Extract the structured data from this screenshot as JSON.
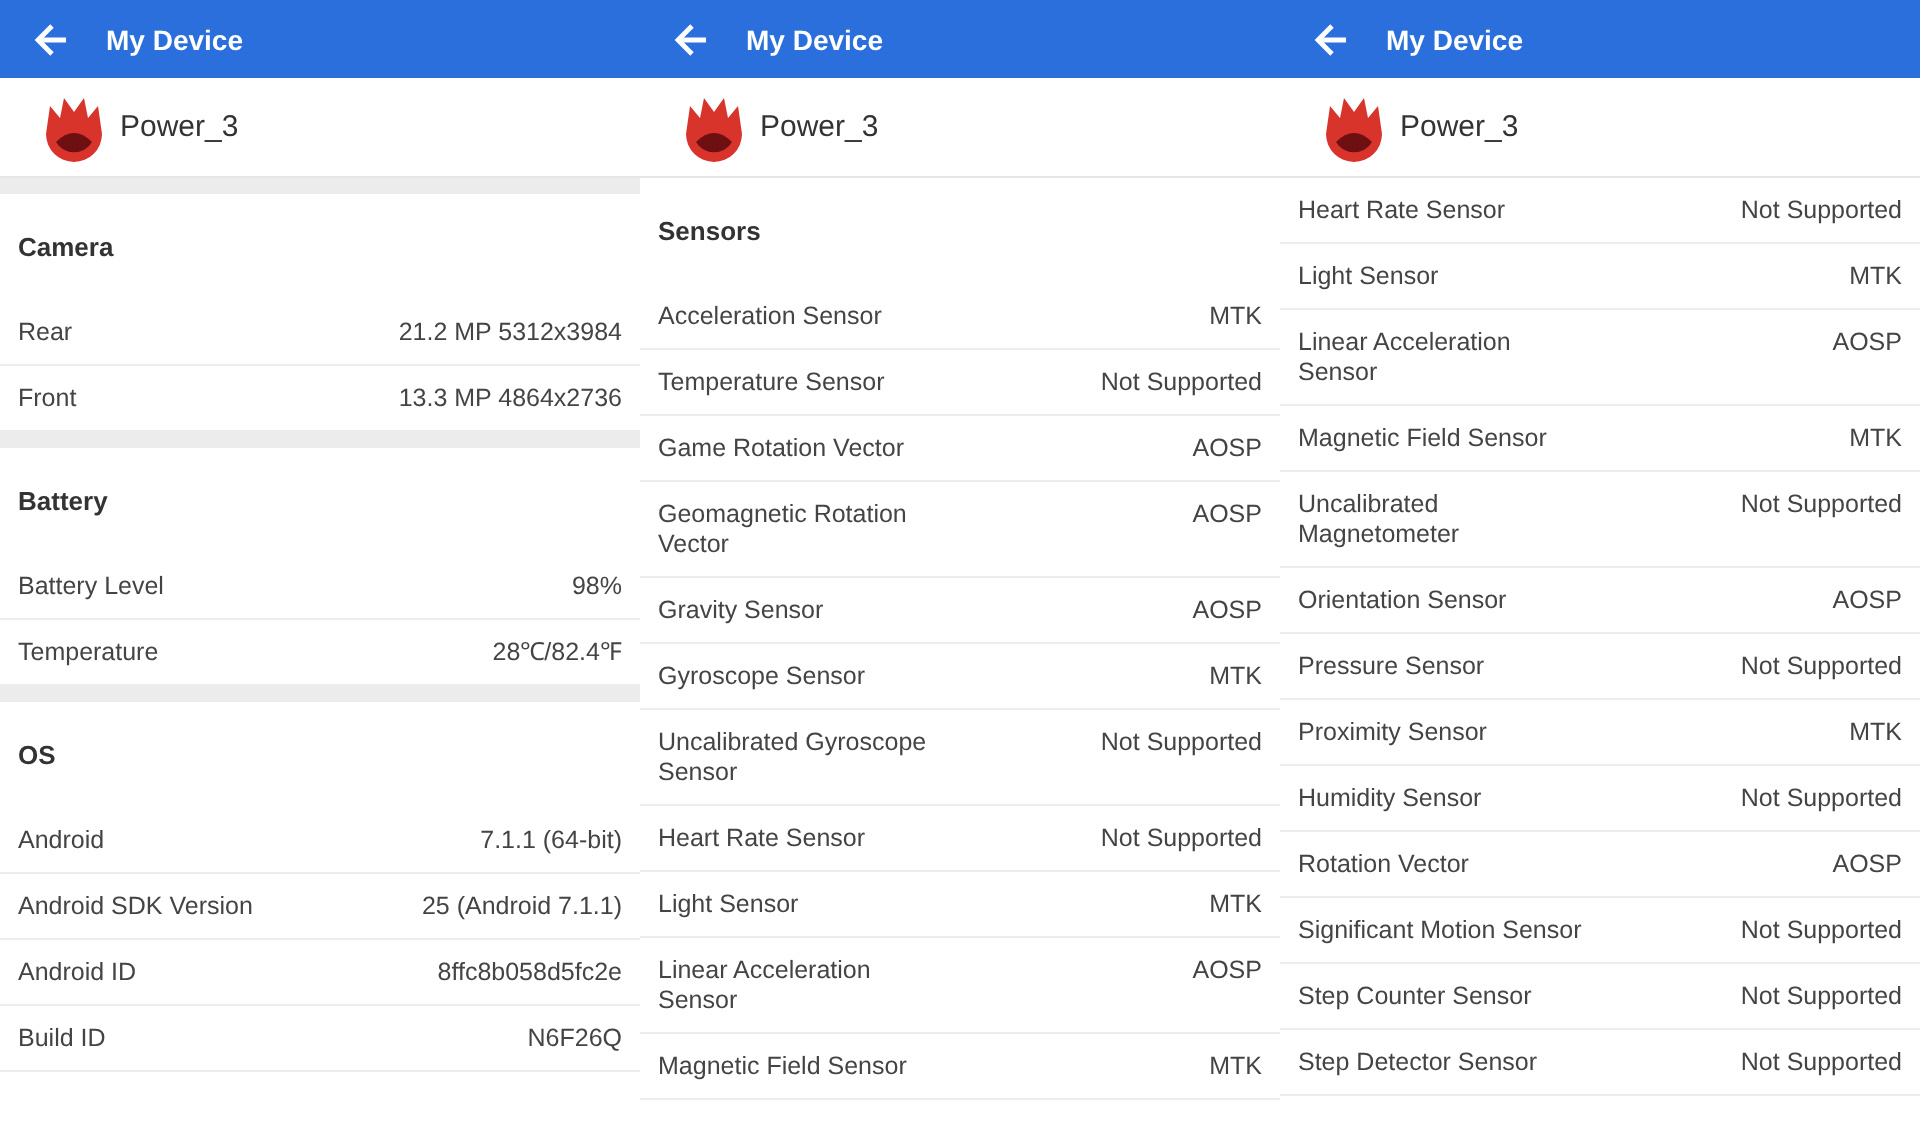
{
  "panels": [
    {
      "title": "My Device",
      "device": "Power_3",
      "items": [
        {
          "kind": "gap"
        },
        {
          "kind": "section",
          "label": "Camera"
        },
        {
          "kind": "row",
          "label": "Rear",
          "value": "21.2 MP 5312x3984"
        },
        {
          "kind": "row",
          "label": "Front",
          "value": "13.3 MP 4864x2736"
        },
        {
          "kind": "gap"
        },
        {
          "kind": "section",
          "label": "Battery"
        },
        {
          "kind": "row",
          "label": "Battery Level",
          "value": "98%"
        },
        {
          "kind": "row",
          "label": "Temperature",
          "value": "28℃/82.4℉"
        },
        {
          "kind": "gap"
        },
        {
          "kind": "section",
          "label": "OS"
        },
        {
          "kind": "row",
          "label": "Android",
          "value": "7.1.1 (64-bit)"
        },
        {
          "kind": "row",
          "label": "Android SDK Version",
          "value": "25 (Android 7.1.1)"
        },
        {
          "kind": "row",
          "label": "Android ID",
          "value": "8ffc8b058d5fc2e"
        },
        {
          "kind": "row",
          "label": "Build ID",
          "value": "N6F26Q"
        }
      ]
    },
    {
      "title": "My Device",
      "device": "Power_3",
      "items": [
        {
          "kind": "section",
          "label": "Sensors"
        },
        {
          "kind": "row",
          "label": "Acceleration Sensor",
          "value": "MTK"
        },
        {
          "kind": "row",
          "label": "Temperature Sensor",
          "value": "Not Supported"
        },
        {
          "kind": "row",
          "label": "Game Rotation Vector",
          "value": "AOSP"
        },
        {
          "kind": "row",
          "label": "Geomagnetic Rotation Vector",
          "value": "AOSP"
        },
        {
          "kind": "row",
          "label": "Gravity Sensor",
          "value": "AOSP"
        },
        {
          "kind": "row",
          "label": "Gyroscope Sensor",
          "value": "MTK"
        },
        {
          "kind": "row",
          "label": "Uncalibrated Gyroscope Sensor",
          "value": "Not Supported"
        },
        {
          "kind": "row",
          "label": "Heart Rate Sensor",
          "value": "Not Supported"
        },
        {
          "kind": "row",
          "label": "Light Sensor",
          "value": "MTK"
        },
        {
          "kind": "row",
          "label": "Linear Acceleration Sensor",
          "value": "AOSP"
        },
        {
          "kind": "row",
          "label": "Magnetic Field Sensor",
          "value": "MTK"
        }
      ]
    },
    {
      "title": "My Device",
      "device": "Power_3",
      "items": [
        {
          "kind": "row",
          "label": "Heart Rate Sensor",
          "value": "Not Supported"
        },
        {
          "kind": "row",
          "label": "Light Sensor",
          "value": "MTK"
        },
        {
          "kind": "row",
          "label": "Linear Acceleration Sensor",
          "value": "AOSP"
        },
        {
          "kind": "row",
          "label": "Magnetic Field Sensor",
          "value": "MTK"
        },
        {
          "kind": "row",
          "label": "Uncalibrated Magnetometer",
          "value": "Not Supported"
        },
        {
          "kind": "row",
          "label": "Orientation Sensor",
          "value": "AOSP"
        },
        {
          "kind": "row",
          "label": "Pressure Sensor",
          "value": "Not Supported"
        },
        {
          "kind": "row",
          "label": "Proximity Sensor",
          "value": "MTK"
        },
        {
          "kind": "row",
          "label": "Humidity Sensor",
          "value": "Not Supported"
        },
        {
          "kind": "row",
          "label": "Rotation Vector",
          "value": "AOSP"
        },
        {
          "kind": "row",
          "label": "Significant Motion Sensor",
          "value": "Not Supported"
        },
        {
          "kind": "row",
          "label": "Step Counter Sensor",
          "value": "Not Supported"
        },
        {
          "kind": "row",
          "label": "Step Detector Sensor",
          "value": "Not Supported"
        }
      ]
    }
  ]
}
